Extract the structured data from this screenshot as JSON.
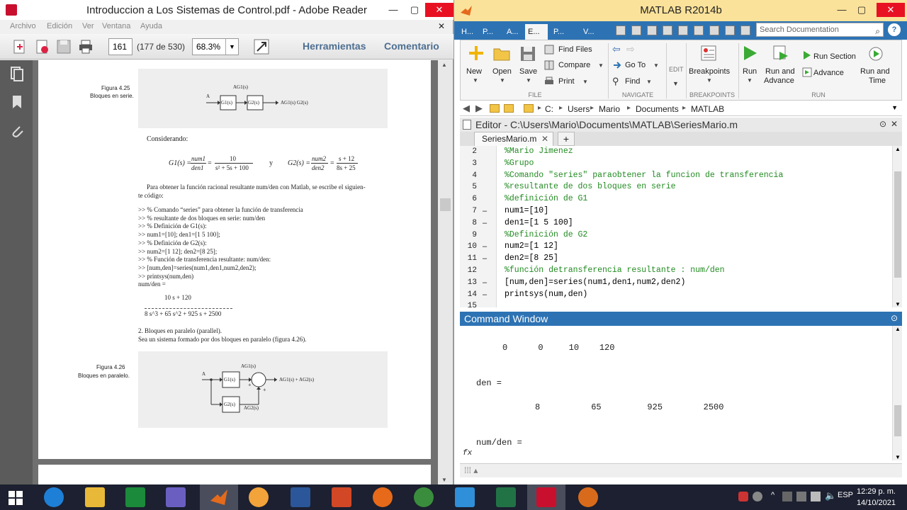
{
  "reader": {
    "title": "Introduccion a Los Sistemas de Control.pdf - Adobe Reader",
    "menu": [
      "Archivo",
      "Edición",
      "Ver",
      "Ventana",
      "Ayuda"
    ],
    "page_number": "161",
    "page_of": "(177 de 530)",
    "zoom": "68.3%",
    "tools_label": "Herramientas",
    "comment_label": "Comentario",
    "doc": {
      "fig425_label": "Figura 4.25",
      "fig425_caption": "Bloques en serie.",
      "considerando": "Considerando:",
      "eq_g1_lhs": "G1(s) =",
      "eq_g1_num": "num1",
      "eq_g1_den": "den1",
      "eq_g1_num2": "10",
      "eq_g1_den2": "s² + 5s + 100",
      "eq_y": "y",
      "eq_g2_lhs": "G2(s) =",
      "eq_g2_num": "num2",
      "eq_g2_den": "den2",
      "eq_g2_num2": "s + 12",
      "eq_g2_den2": "8s + 25",
      "para1_line1": "Para obtener la función racional resultante num/den con Matlab, se escribe el siguien-",
      "para1_line2": "te código:",
      "code_lines": [
        ">> % Comando “series” para obtener la función de transferencia",
        ">> % resultante de dos bloques en serie: num/den",
        ">> % Definición de G1(s):",
        ">> num1=[10]; den1=[1 5 100];",
        ">> % Definición de G2(s):",
        ">> num2=[1 12]; den2=[8 25];",
        ">> % Función de transferencia resultante: num/den:",
        ">> [num,den]=series(num1,den1,num2,den2);",
        ">> printsys(num,den)",
        "num/den ="
      ],
      "result_num": "10 s + 120",
      "result_den": "8 s^3 + 65 s^2 + 925 s + 2500",
      "section2_title": "2. Bloques en paralelo (parallel).",
      "section2_text": "Sea un sistema formado por dos bloques en paralelo (figura 4.26).",
      "fig426_label": "Figura 4.26",
      "fig426_caption": "Bloques en paralelo.",
      "d1_top": "AG1(s)",
      "d1_a": "A",
      "d1_g1": "G1(s)",
      "d1_g2": "G2(s)",
      "d1_out": "AG1(s) G2(s)",
      "d2_a": "A",
      "d2_top": "AG1(s)",
      "d2_g1": "G1(s)",
      "d2_g2": "G2(s)",
      "d2_bottom": "AG2(s)",
      "d2_out": "AG1(s) + AG2(s)",
      "d2_plus1": "+",
      "d2_plus2": "+"
    }
  },
  "matlab": {
    "title": "MATLAB R2014b",
    "tabs": [
      "H...",
      "P...",
      "A...",
      "E...",
      "P...",
      "V..."
    ],
    "search_placeholder": "Search Documentation",
    "ribbon": {
      "new": "New",
      "open": "Open",
      "save": "Save",
      "find_files": "Find Files",
      "compare": "Compare",
      "print": "Print",
      "go_to": "Go To",
      "find": "Find",
      "edit": "EDIT",
      "breakpoints": "Breakpoints",
      "run": "Run",
      "run_advance_1": "Run and",
      "run_advance_2": "Advance",
      "run_section": "Run Section",
      "advance": "Advance",
      "run_time_1": "Run and",
      "run_time_2": "Time",
      "sec_file": "FILE",
      "sec_navigate": "NAVIGATE",
      "sec_breakpoints": "BREAKPOINTS",
      "sec_run": "RUN"
    },
    "path": [
      "C:",
      "Users",
      "Mario",
      "Documents",
      "MATLAB"
    ],
    "editor_title": "Editor - C:\\Users\\Mario\\Documents\\MATLAB\\SeriesMario.m",
    "file_tab": "SeriesMario.m",
    "code_lines": [
      {
        "n": "2",
        "dash": "",
        "text": "%Mario Jimenez",
        "comment": true
      },
      {
        "n": "3",
        "dash": "",
        "text": "%Grupo",
        "comment": true
      },
      {
        "n": "4",
        "dash": "",
        "text": "%Comando \"series\" paraobtener la funcion de transferencia",
        "comment": true
      },
      {
        "n": "5",
        "dash": "",
        "text": "%resultante de dos bloques en serie",
        "comment": true
      },
      {
        "n": "6",
        "dash": "",
        "text": "%definición de G1",
        "comment": true
      },
      {
        "n": "7",
        "dash": "–",
        "text": "num1=[10]",
        "comment": false
      },
      {
        "n": "8",
        "dash": "–",
        "text": "den1=[1 5 100]",
        "comment": false
      },
      {
        "n": "9",
        "dash": "",
        "text": "%Definición de G2",
        "comment": true
      },
      {
        "n": "10",
        "dash": "–",
        "text": "num2=[1 12]",
        "comment": false
      },
      {
        "n": "11",
        "dash": "–",
        "text": "den2=[8 25]",
        "comment": false
      },
      {
        "n": "12",
        "dash": "",
        "text": "%función detransferencia resultante : num/den",
        "comment": true
      },
      {
        "n": "13",
        "dash": "–",
        "text": "[num,den]=series(num1,den1,num2,den2)",
        "comment": false
      },
      {
        "n": "14",
        "dash": "–",
        "text": "printsys(num,den)",
        "comment": false
      },
      {
        "n": "15",
        "dash": "",
        "text": "",
        "comment": false
      }
    ],
    "command_window_title": "Command Window",
    "cw": {
      "row1": "0      0     10    120",
      "den_label": "den =",
      "row2": "8          65         925        2500",
      "numden_label": "num/den =",
      "fx": "fx"
    }
  },
  "taskbar": {
    "time": "12:29 p. m.",
    "date": "14/10/2021"
  }
}
